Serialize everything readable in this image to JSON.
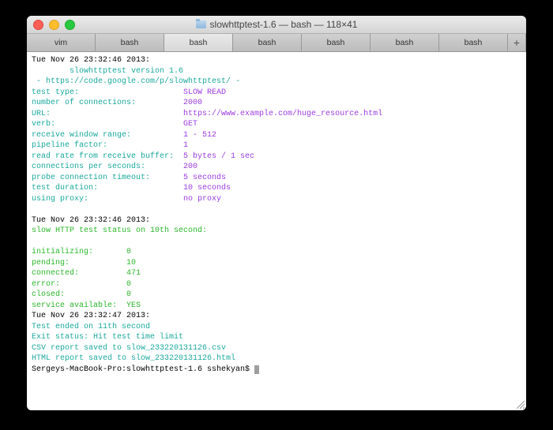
{
  "window": {
    "title": "slowhttptest-1.6 — bash — 118×41"
  },
  "tabs": [
    "vim",
    "bash",
    "bash",
    "bash",
    "bash",
    "bash",
    "bash"
  ],
  "active_tab_index": 2,
  "add_tab": "+",
  "output": {
    "ts1": "Tue Nov 26 23:32:46 2013:",
    "version_indent": "\t",
    "version": "slowhttptest version 1.6",
    "url_line_prefix": " - ",
    "url_line": "https://code.google.com/p/slowhttptest/",
    "url_line_suffix": " -",
    "params": [
      {
        "label": "test type:",
        "value": "SLOW READ"
      },
      {
        "label": "number of connections:",
        "value": "2000"
      },
      {
        "label": "URL:",
        "value": "https://www.example.com/huge_resource.html"
      },
      {
        "label": "verb:",
        "value": "GET"
      },
      {
        "label": "receive window range:",
        "value": "1 - 512"
      },
      {
        "label": "pipeline factor:",
        "value": "1"
      },
      {
        "label": "read rate from receive buffer:",
        "value": "5 bytes / 1 sec"
      },
      {
        "label": "connections per seconds:",
        "value": "200"
      },
      {
        "label": "probe connection timeout:",
        "value": "5 seconds"
      },
      {
        "label": "test duration:",
        "value": "10 seconds"
      },
      {
        "label": "using proxy:",
        "value": "no proxy"
      }
    ],
    "ts2": "Tue Nov 26 23:32:46 2013:",
    "status_header": "slow HTTP test status on 10th second:",
    "status": [
      {
        "label": "initializing:",
        "value": "0"
      },
      {
        "label": "pending:",
        "value": "10"
      },
      {
        "label": "connected:",
        "value": "471"
      },
      {
        "label": "error:",
        "value": "0"
      },
      {
        "label": "closed:",
        "value": "0"
      },
      {
        "label": "service available:",
        "value": "YES"
      }
    ],
    "ts3": "Tue Nov 26 23:32:47 2013:",
    "end_lines": [
      "Test ended on 11th second",
      "Exit status: Hit test time limit",
      "CSV report saved to slow_233220131126.csv",
      "HTML report saved to slow_233220131126.html"
    ],
    "prompt": "Sergeys-MacBook-Pro:slowhttptest-1.6 sshekyan$ "
  }
}
